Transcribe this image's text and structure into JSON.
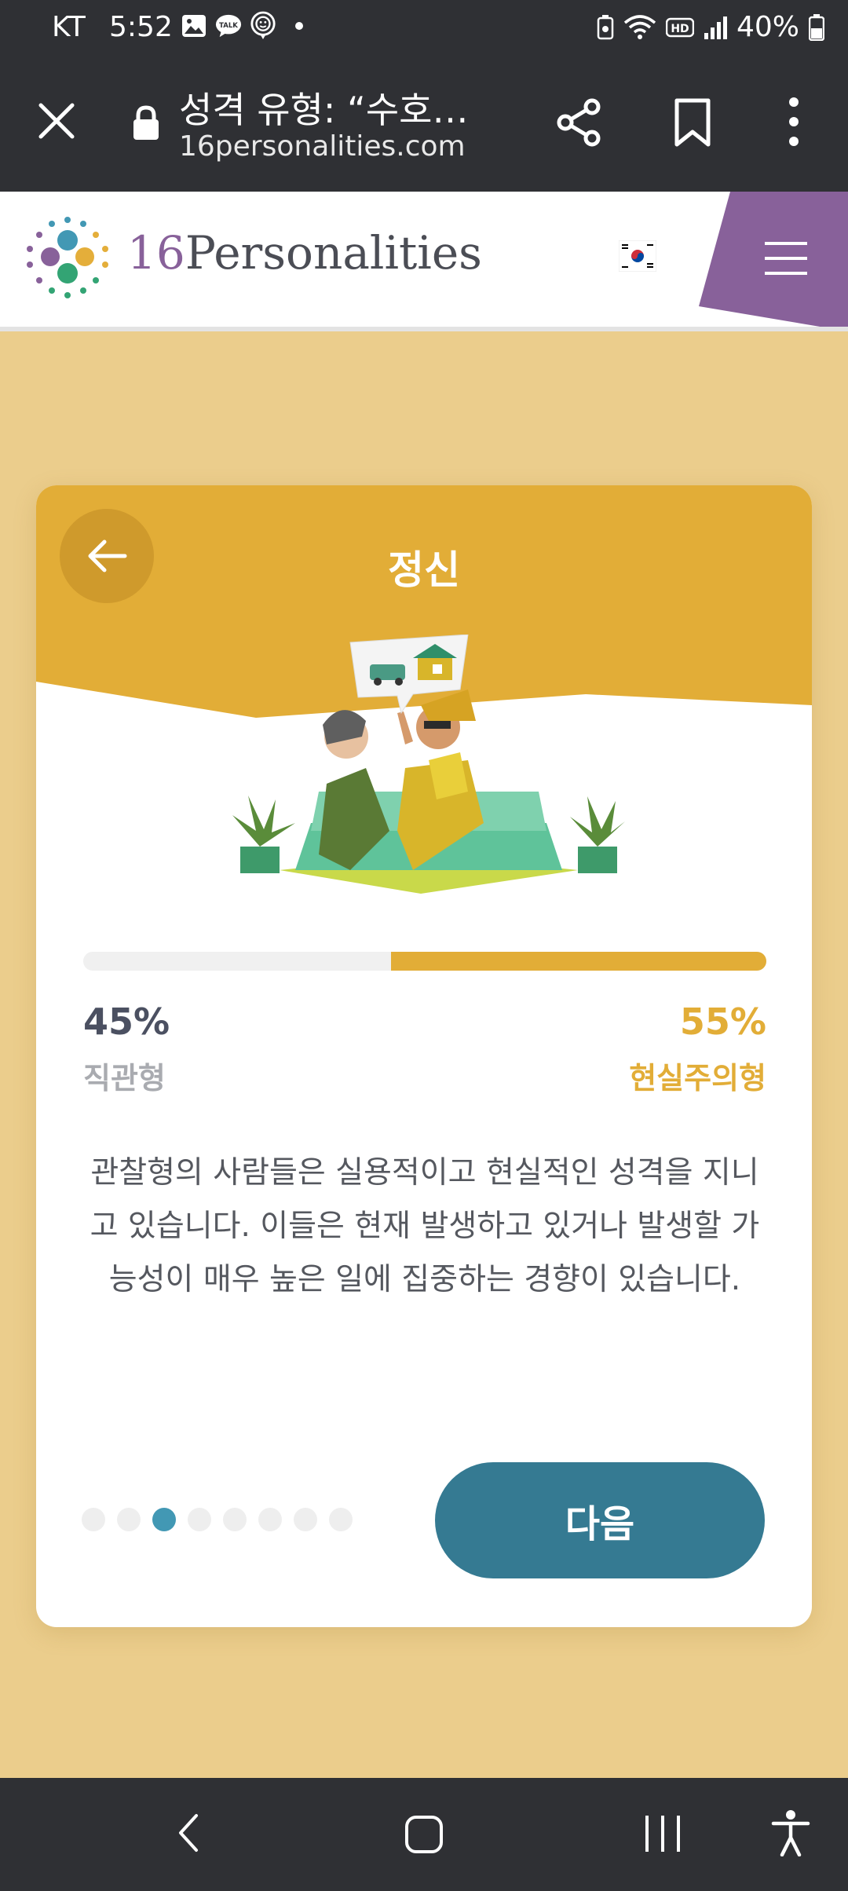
{
  "status_bar": {
    "carrier": "KT",
    "time": "5:52",
    "notification_icons": [
      "gallery-icon",
      "kakaotalk-icon",
      "smiley-icon"
    ],
    "right_icons": [
      "battery-saver-icon",
      "wifi-icon",
      "hd-icon",
      "signal-icon"
    ],
    "battery": "40%"
  },
  "browser": {
    "title": "성격 유형: “수호…",
    "url": "16personalities.com"
  },
  "site": {
    "logo_number": "16",
    "logo_text": "Personalities",
    "flag": "korea-flag"
  },
  "card": {
    "title": "정신",
    "progress": {
      "left_percent": 45,
      "right_percent": 55
    },
    "left_value": "45%",
    "right_value": "55%",
    "left_label": "직관형",
    "right_label": "현실주의형",
    "description": "관찰형의 사람들은 실용적이고 현실적인 성격을 지니고 있습니다. 이들은 현재 발생하고 있거나 발생할 가능성이 매우 높은 일에 집중하는 경향이 있습니다.",
    "pagination": {
      "total": 8,
      "active_index": 2
    },
    "next_label": "다음"
  },
  "colors": {
    "page_bg": "#ebcd8c",
    "card_accent": "#e2ad37",
    "next_button": "#357a92",
    "active_dot": "#4298b4",
    "menu_purple": "#88619a",
    "system_bar": "#2f3034"
  }
}
